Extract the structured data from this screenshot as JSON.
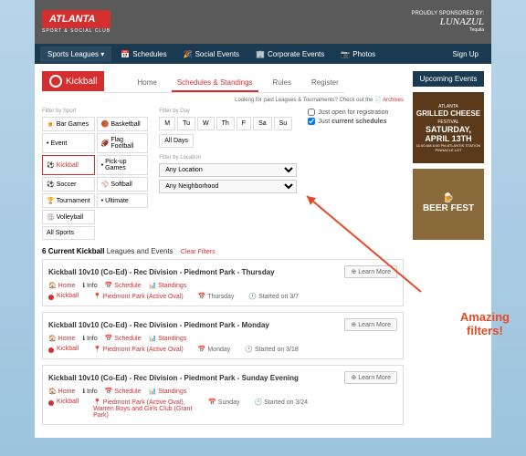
{
  "header": {
    "logo": "ATLANTA",
    "logo_sub": "SPORT & SOCIAL CLUB",
    "sponsor_label": "PROUDLY SPONSORED BY:",
    "sponsor": "LUNAZUL",
    "sponsor_sub": "Tequila"
  },
  "nav": {
    "items": [
      "Sports Leagues ▾",
      "Schedules",
      "Social Events",
      "Corporate Events",
      "Photos",
      "Sign Up"
    ]
  },
  "page_title": "Kickball",
  "tabs": [
    "Home",
    "Schedules & Standings",
    "Rules",
    "Register"
  ],
  "active_tab": 1,
  "archive_note": "Looking for past Leagues & Tournaments? Check out the",
  "archive_link": "Archives",
  "filters": {
    "sport_label": "Filter by Sport",
    "sports": [
      "Bar Games",
      "Basketball",
      "Event",
      "Flag Football",
      "Kickball",
      "Pick-up Games",
      "Soccer",
      "Softball",
      "Tournament",
      "Ultimate",
      "Volleyball"
    ],
    "all_sports": "All Sports",
    "selected_sport": "Kickball",
    "day_label": "Filter by Day",
    "days": [
      "M",
      "Tu",
      "W",
      "Th",
      "F",
      "Sa",
      "Su"
    ],
    "all_days": "All Days",
    "location_label": "Filter by Location",
    "location_opts": [
      "Any Location",
      "Any Neighborhood"
    ],
    "check1": "Just open for registration",
    "check2": "Just current schedules"
  },
  "sidebar": {
    "upcoming": "Upcoming Events",
    "ad1": {
      "pre": "ATLANTA",
      "title": "GRILLED CHEESE",
      "sub": "FESTIVAL",
      "date": "SATURDAY, APRIL 13TH",
      "foot": "11:00 AM-6:00 PM ATLANTIS STATION PINNACLE LOT"
    },
    "ad2": {
      "title": "BEER FEST"
    }
  },
  "results": {
    "count": "6",
    "label": "Current Kickball Leagues and Events",
    "clear": "Clear Filters"
  },
  "cards": [
    {
      "title": "Kickball 10v10 (Co-Ed) - Rec Division - Piedmont Park - Thursday",
      "sport": "Kickball",
      "loc": "Piedmont Park (Active Oval)",
      "day": "Thursday",
      "start": "Started on 3/7"
    },
    {
      "title": "Kickball 10v10 (Co-Ed) - Rec Division - Piedmont Park - Monday",
      "sport": "Kickball",
      "loc": "Piedmont Park (Active Oval)",
      "day": "Monday",
      "start": "Started on 3/18"
    },
    {
      "title": "Kickball 10v10 (Co-Ed) - Rec Division - Piedmont Park - Sunday Evening",
      "sport": "Kickball",
      "loc": "Piedmont Park (Active Oval), Warren Boys and Girls Club (Grant Park)",
      "day": "Sunday",
      "start": "Started on 3/24"
    }
  ],
  "card_tabs": {
    "home": "Home",
    "info": "Info",
    "schedule": "Schedule",
    "standings": "Standings"
  },
  "learn_more": "Learn More",
  "callout": "Amazing\nfilters!"
}
